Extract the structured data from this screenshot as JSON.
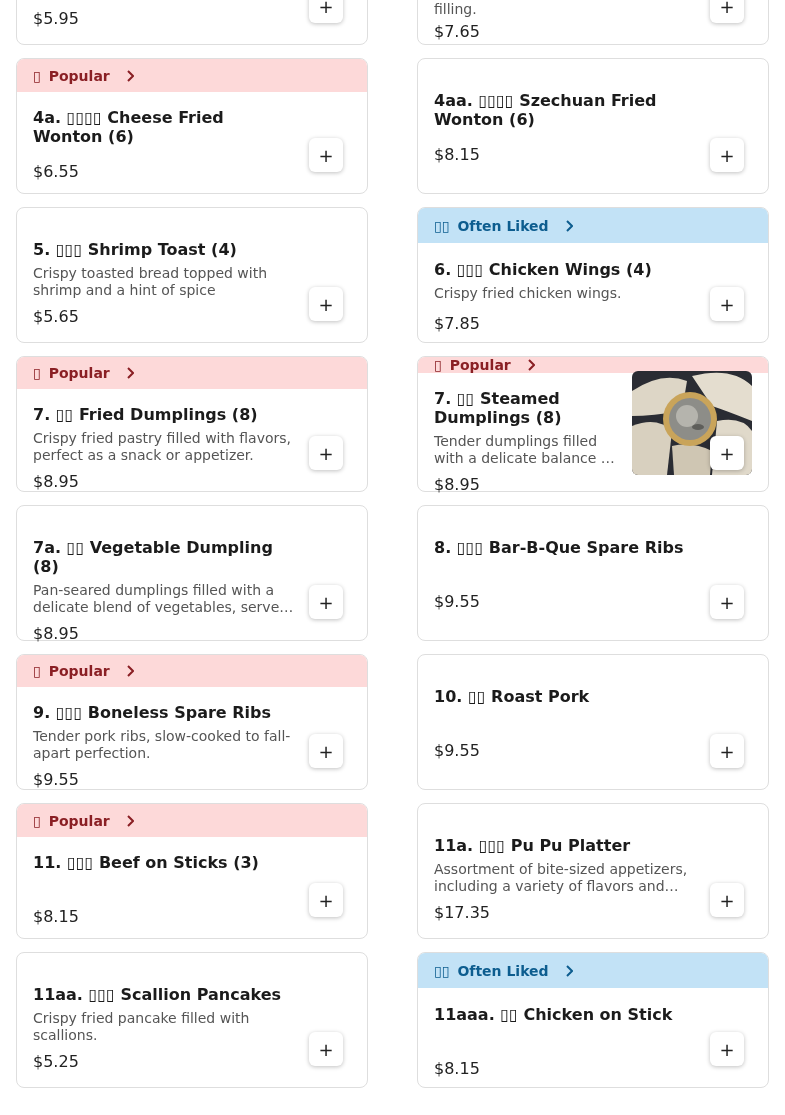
{
  "rows": [
    {
      "cards": [
        {
          "price": "$5.95",
          "button": "+"
        },
        {
          "description": "filling.",
          "price": "$7.65",
          "button": "+"
        }
      ]
    },
    {
      "cards": [
        {
          "banner": {
            "kind": "popular",
            "icon": "▯",
            "label": "Popular"
          },
          "name": "4a. ▯▯▯▯ Cheese Fried Wonton (6)",
          "price": "$6.55",
          "button": "+"
        },
        {
          "name": "4aa. ▯▯▯▯ Szechuan Fried Wonton (6)",
          "price": "$8.15",
          "button": "+"
        }
      ]
    },
    {
      "cards": [
        {
          "name": "5. ▯▯▯ Shrimp Toast (4)",
          "description": "Crispy toasted bread topped with shrimp and a hint of spice",
          "price": "$5.65",
          "button": "+"
        },
        {
          "banner": {
            "kind": "often_liked",
            "icon": "▯▯",
            "label": "Often Liked"
          },
          "name": "6. ▯▯▯ Chicken Wings (4)",
          "description": "Crispy fried chicken wings.",
          "price": "$7.85",
          "button": "+"
        }
      ]
    },
    {
      "cards": [
        {
          "banner": {
            "kind": "popular",
            "icon": "▯",
            "label": "Popular"
          },
          "name": "7. ▯▯ Fried Dumplings (8)",
          "description": "Crispy fried pastry filled with flavors, perfect as a snack or appetizer.",
          "price": "$8.95",
          "button": "+"
        },
        {
          "banner": {
            "kind": "popular",
            "icon": "▯",
            "label": "Popular"
          },
          "name": "7. ▯▯ Steamed Dumplings (8)",
          "description": "Tender dumplings filled with a delicate balance …",
          "price": "$8.95",
          "button": "+"
        }
      ]
    },
    {
      "cards": [
        {
          "name": "7a. ▯▯ Vegetable Dumpling (8)",
          "description": "Pan-seared dumplings filled with a delicate blend of vegetables, serve…",
          "price": "$8.95",
          "button": "+"
        },
        {
          "name": "8. ▯▯▯ Bar-B-Que Spare Ribs",
          "price": "$9.55",
          "button": "+"
        }
      ]
    },
    {
      "cards": [
        {
          "banner": {
            "kind": "popular",
            "icon": "▯",
            "label": "Popular"
          },
          "name": "9. ▯▯▯ Boneless Spare Ribs",
          "description": "Tender pork ribs, slow-cooked to fall-apart perfection.",
          "price": "$9.55",
          "button": "+"
        },
        {
          "name": "10. ▯▯ Roast Pork",
          "price": "$9.55",
          "button": "+"
        }
      ]
    },
    {
      "cards": [
        {
          "banner": {
            "kind": "popular",
            "icon": "▯",
            "label": "Popular"
          },
          "name": "11. ▯▯▯ Beef on Sticks (3)",
          "price": "$8.15",
          "button": "+"
        },
        {
          "name": "11a. ▯▯▯ Pu Pu Platter",
          "description": "Assortment of bite-sized appetizers, including a variety of flavors and…",
          "price": "$17.35",
          "button": "+"
        }
      ]
    },
    {
      "cards": [
        {
          "name": "11aa. ▯▯▯ Scallion Pancakes",
          "description": "Crispy fried pancake filled with scallions.",
          "price": "$5.25",
          "button": "+"
        },
        {
          "banner": {
            "kind": "often_liked",
            "icon": "▯▯",
            "label": "Often Liked"
          },
          "name": "11aaa. ▯▯ Chicken on Stick",
          "price": "$8.15",
          "button": "+"
        }
      ]
    }
  ]
}
